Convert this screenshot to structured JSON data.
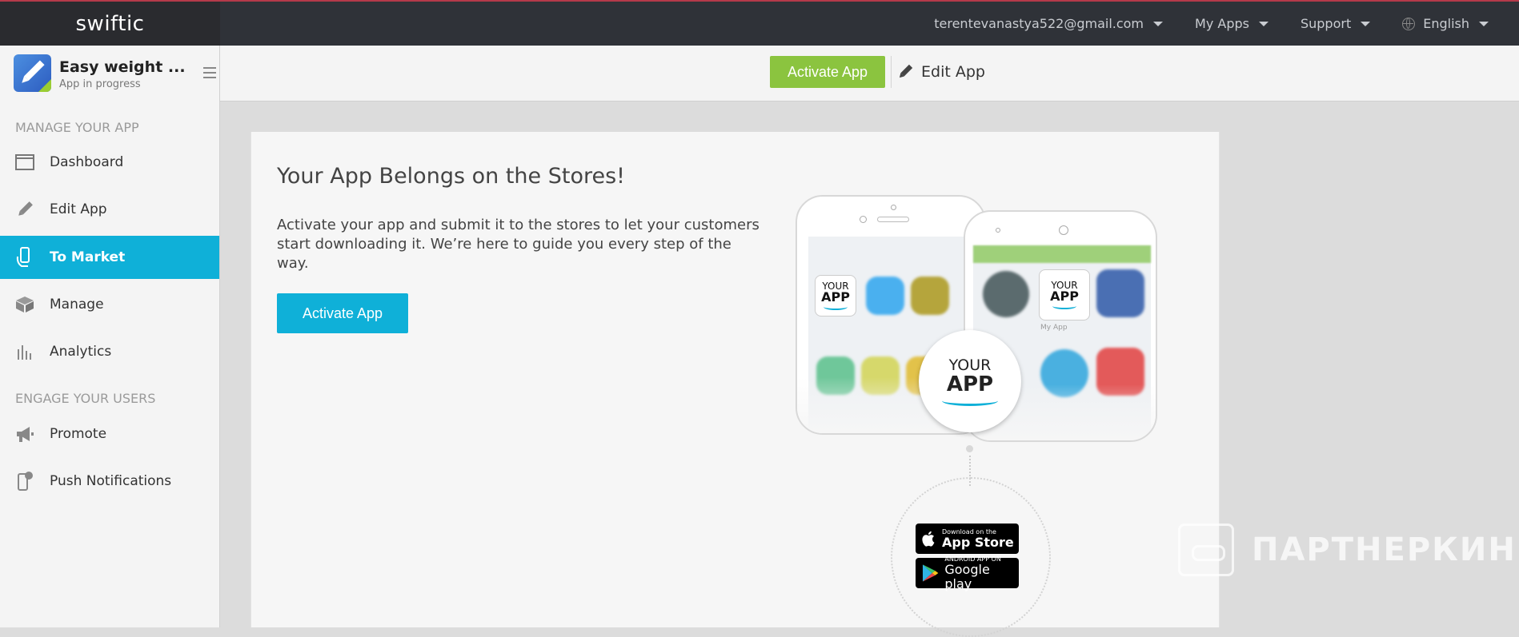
{
  "topbar": {
    "logo": "swiftic",
    "account_email": "terentevanastya522@gmail.com",
    "my_apps": "My Apps",
    "support": "Support",
    "language": "English"
  },
  "sidebar": {
    "app_name": "Easy weight ...",
    "app_status": "App in progress",
    "section_manage": "MANAGE YOUR APP",
    "section_engage": "ENGAGE YOUR USERS",
    "items": [
      {
        "label": "Dashboard",
        "icon": "dashboard-icon"
      },
      {
        "label": "Edit App",
        "icon": "pencil-icon"
      },
      {
        "label": "To Market",
        "icon": "phone-hand-icon",
        "active": true
      },
      {
        "label": "Manage",
        "icon": "box-icon"
      },
      {
        "label": "Analytics",
        "icon": "bar-chart-icon"
      },
      {
        "label": "Promote",
        "icon": "megaphone-icon"
      },
      {
        "label": "Push Notifications",
        "icon": "phone-notification-icon"
      }
    ]
  },
  "subheader": {
    "activate_label": "Activate App",
    "edit_label": "Edit App"
  },
  "main": {
    "title": "Your App Belongs on the Stores!",
    "text": "Activate your app and submit it to the stores to let your customers start downloading it. We’re here to guide you every step of the way.",
    "activate_label": "Activate App",
    "illustration": {
      "tile_line1": "YOUR",
      "tile_line2": "APP",
      "my_app_label": "My App",
      "appstore_small": "Download on the",
      "appstore_big": "App Store",
      "googleplay_small": "ANDROID APP ON",
      "googleplay_big": "Google play"
    }
  },
  "watermark": "ПАРТНЕРКИН",
  "colors": {
    "accent_blue": "#0fb0d8",
    "accent_green": "#8bc43f",
    "topbar_bg": "#2f3238"
  }
}
